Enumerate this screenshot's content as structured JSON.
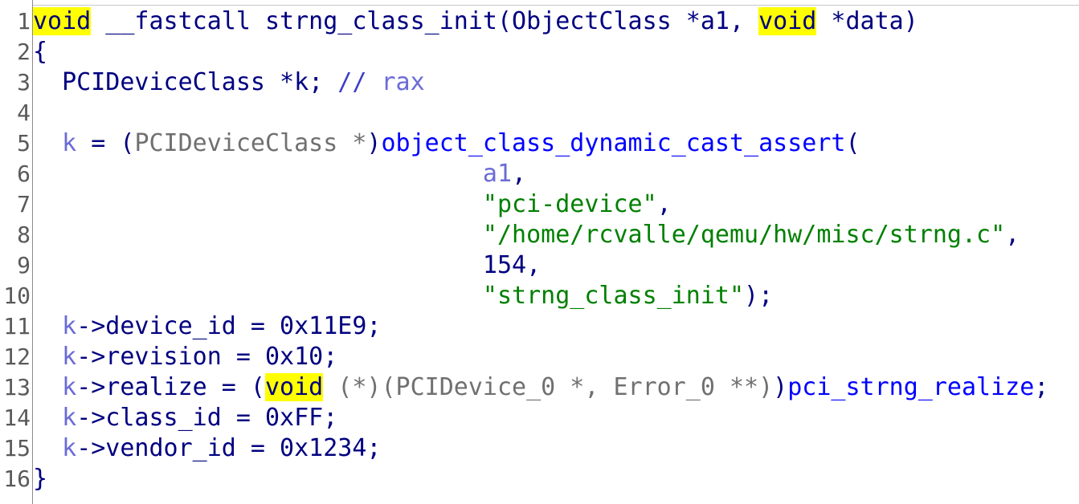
{
  "editor": {
    "lines": [
      {
        "no": "1",
        "tokens": [
          {
            "t": "void",
            "c": "kw-hl"
          },
          {
            "t": " __fastcall strng_class_init(ObjectClass *a1, ",
            "c": ""
          },
          {
            "t": "void",
            "c": "kw-hl"
          },
          {
            "t": " *data)",
            "c": ""
          }
        ]
      },
      {
        "no": "2",
        "tokens": [
          {
            "t": "{",
            "c": ""
          }
        ]
      },
      {
        "no": "3",
        "tokens": [
          {
            "t": "  PCIDeviceClass *k; ",
            "c": ""
          },
          {
            "t": "// ",
            "c": "cmt"
          },
          {
            "t": "rax",
            "c": "var"
          }
        ]
      },
      {
        "no": "4",
        "tokens": [
          {
            "t": "",
            "c": ""
          }
        ]
      },
      {
        "no": "5",
        "tokens": [
          {
            "t": "  ",
            "c": ""
          },
          {
            "t": "k",
            "c": "var"
          },
          {
            "t": " = (",
            "c": ""
          },
          {
            "t": "PCIDeviceClass *",
            "c": "cast"
          },
          {
            "t": ")",
            "c": ""
          },
          {
            "t": "object_class_dynamic_cast_assert",
            "c": "func"
          },
          {
            "t": "(",
            "c": ""
          }
        ]
      },
      {
        "no": "6",
        "tokens": [
          {
            "t": "                               ",
            "c": ""
          },
          {
            "t": "a1",
            "c": "var"
          },
          {
            "t": ",",
            "c": ""
          }
        ]
      },
      {
        "no": "7",
        "tokens": [
          {
            "t": "                               ",
            "c": ""
          },
          {
            "t": "\"pci-device\"",
            "c": "str"
          },
          {
            "t": ",",
            "c": ""
          }
        ]
      },
      {
        "no": "8",
        "tokens": [
          {
            "t": "                               ",
            "c": ""
          },
          {
            "t": "\"/home/rcvalle/qemu/hw/misc/strng.c\"",
            "c": "str"
          },
          {
            "t": ",",
            "c": ""
          }
        ]
      },
      {
        "no": "9",
        "tokens": [
          {
            "t": "                               ",
            "c": ""
          },
          {
            "t": "154",
            "c": "num"
          },
          {
            "t": ",",
            "c": ""
          }
        ]
      },
      {
        "no": "10",
        "tokens": [
          {
            "t": "                               ",
            "c": ""
          },
          {
            "t": "\"strng_class_init\"",
            "c": "str"
          },
          {
            "t": ");",
            "c": ""
          }
        ]
      },
      {
        "no": "11",
        "tokens": [
          {
            "t": "  ",
            "c": ""
          },
          {
            "t": "k",
            "c": "var"
          },
          {
            "t": "->device_id = 0x11E9;",
            "c": ""
          }
        ]
      },
      {
        "no": "12",
        "tokens": [
          {
            "t": "  ",
            "c": ""
          },
          {
            "t": "k",
            "c": "var"
          },
          {
            "t": "->revision = 0x10;",
            "c": ""
          }
        ]
      },
      {
        "no": "13",
        "tokens": [
          {
            "t": "  ",
            "c": ""
          },
          {
            "t": "k",
            "c": "var"
          },
          {
            "t": "->realize = (",
            "c": ""
          },
          {
            "t": "void",
            "c": "kw-hl"
          },
          {
            "t": " (*)(PCIDevice_0 *, Error_0 **)",
            "c": "cast"
          },
          {
            "t": ")",
            "c": ""
          },
          {
            "t": "pci_strng_realize",
            "c": "func"
          },
          {
            "t": ";",
            "c": ""
          }
        ]
      },
      {
        "no": "14",
        "tokens": [
          {
            "t": "  ",
            "c": ""
          },
          {
            "t": "k",
            "c": "var"
          },
          {
            "t": "->class_id = 0xFF;",
            "c": ""
          }
        ]
      },
      {
        "no": "15",
        "tokens": [
          {
            "t": "  ",
            "c": ""
          },
          {
            "t": "k",
            "c": "var"
          },
          {
            "t": "->vendor_id = 0x1234;",
            "c": ""
          }
        ]
      },
      {
        "no": "16",
        "tokens": [
          {
            "t": "}",
            "c": ""
          }
        ]
      }
    ]
  }
}
